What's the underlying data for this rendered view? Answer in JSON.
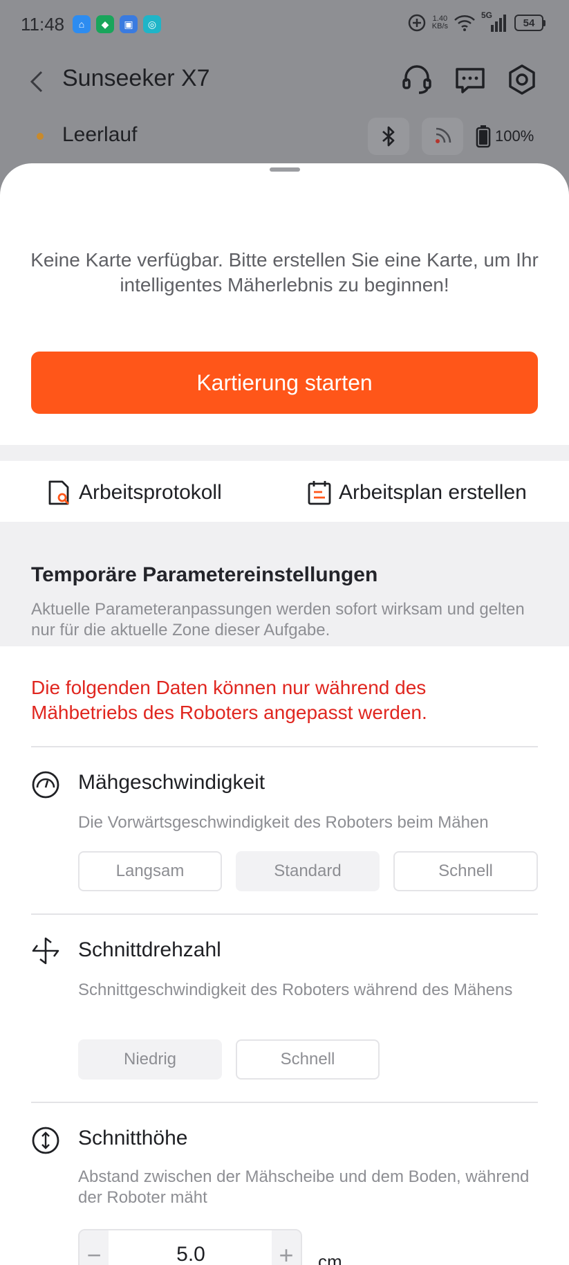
{
  "status_bar": {
    "time": "11:48",
    "net_speed_value": "1.40",
    "net_speed_unit": "KB/s",
    "network": "5G",
    "battery": "54"
  },
  "header": {
    "title": "Sunseeker X7"
  },
  "device": {
    "state": "Leerlauf",
    "battery": "100%"
  },
  "sheet": {
    "no_map_text": "Keine Karte verfügbar. Bitte erstellen Sie eine Karte, um Ihr intelligentes Mäherlebnis zu beginnen!",
    "start_button": "Kartierung starten",
    "links": {
      "log": "Arbeitsprotokoll",
      "plan": "Arbeitsplan erstellen"
    }
  },
  "params": {
    "title": "Temporäre Parametereinstellungen",
    "description": "Aktuelle Parameteranpassungen werden sofort wirksam und gelten nur für die aktuelle Zone dieser Aufgabe.",
    "warning": "Die folgenden Daten können nur während des Mähbetriebs des Roboters angepasst werden.",
    "speed": {
      "title": "Mähgeschwindigkeit",
      "description": "Die Vorwärtsgeschwindigkeit des Roboters beim Mähen",
      "options": [
        "Langsam",
        "Standard",
        "Schnell"
      ],
      "selected": "Standard"
    },
    "cut_speed": {
      "title": "Schnittdrehzahl",
      "description": "Schnittgeschwindigkeit des Roboters während des Mähens",
      "options": [
        "Niedrig",
        "Schnell"
      ],
      "selected": "Niedrig"
    },
    "height": {
      "title": "Schnitthöhe",
      "description": "Abstand zwischen der Mähscheibe und dem Boden, während der Roboter mäht",
      "value": "5.0",
      "unit": "cm",
      "minus": "−",
      "plus": "+"
    }
  },
  "colors": {
    "accent": "#ff5619",
    "warning": "#e0261f",
    "state_dot": "#c98a2b"
  }
}
